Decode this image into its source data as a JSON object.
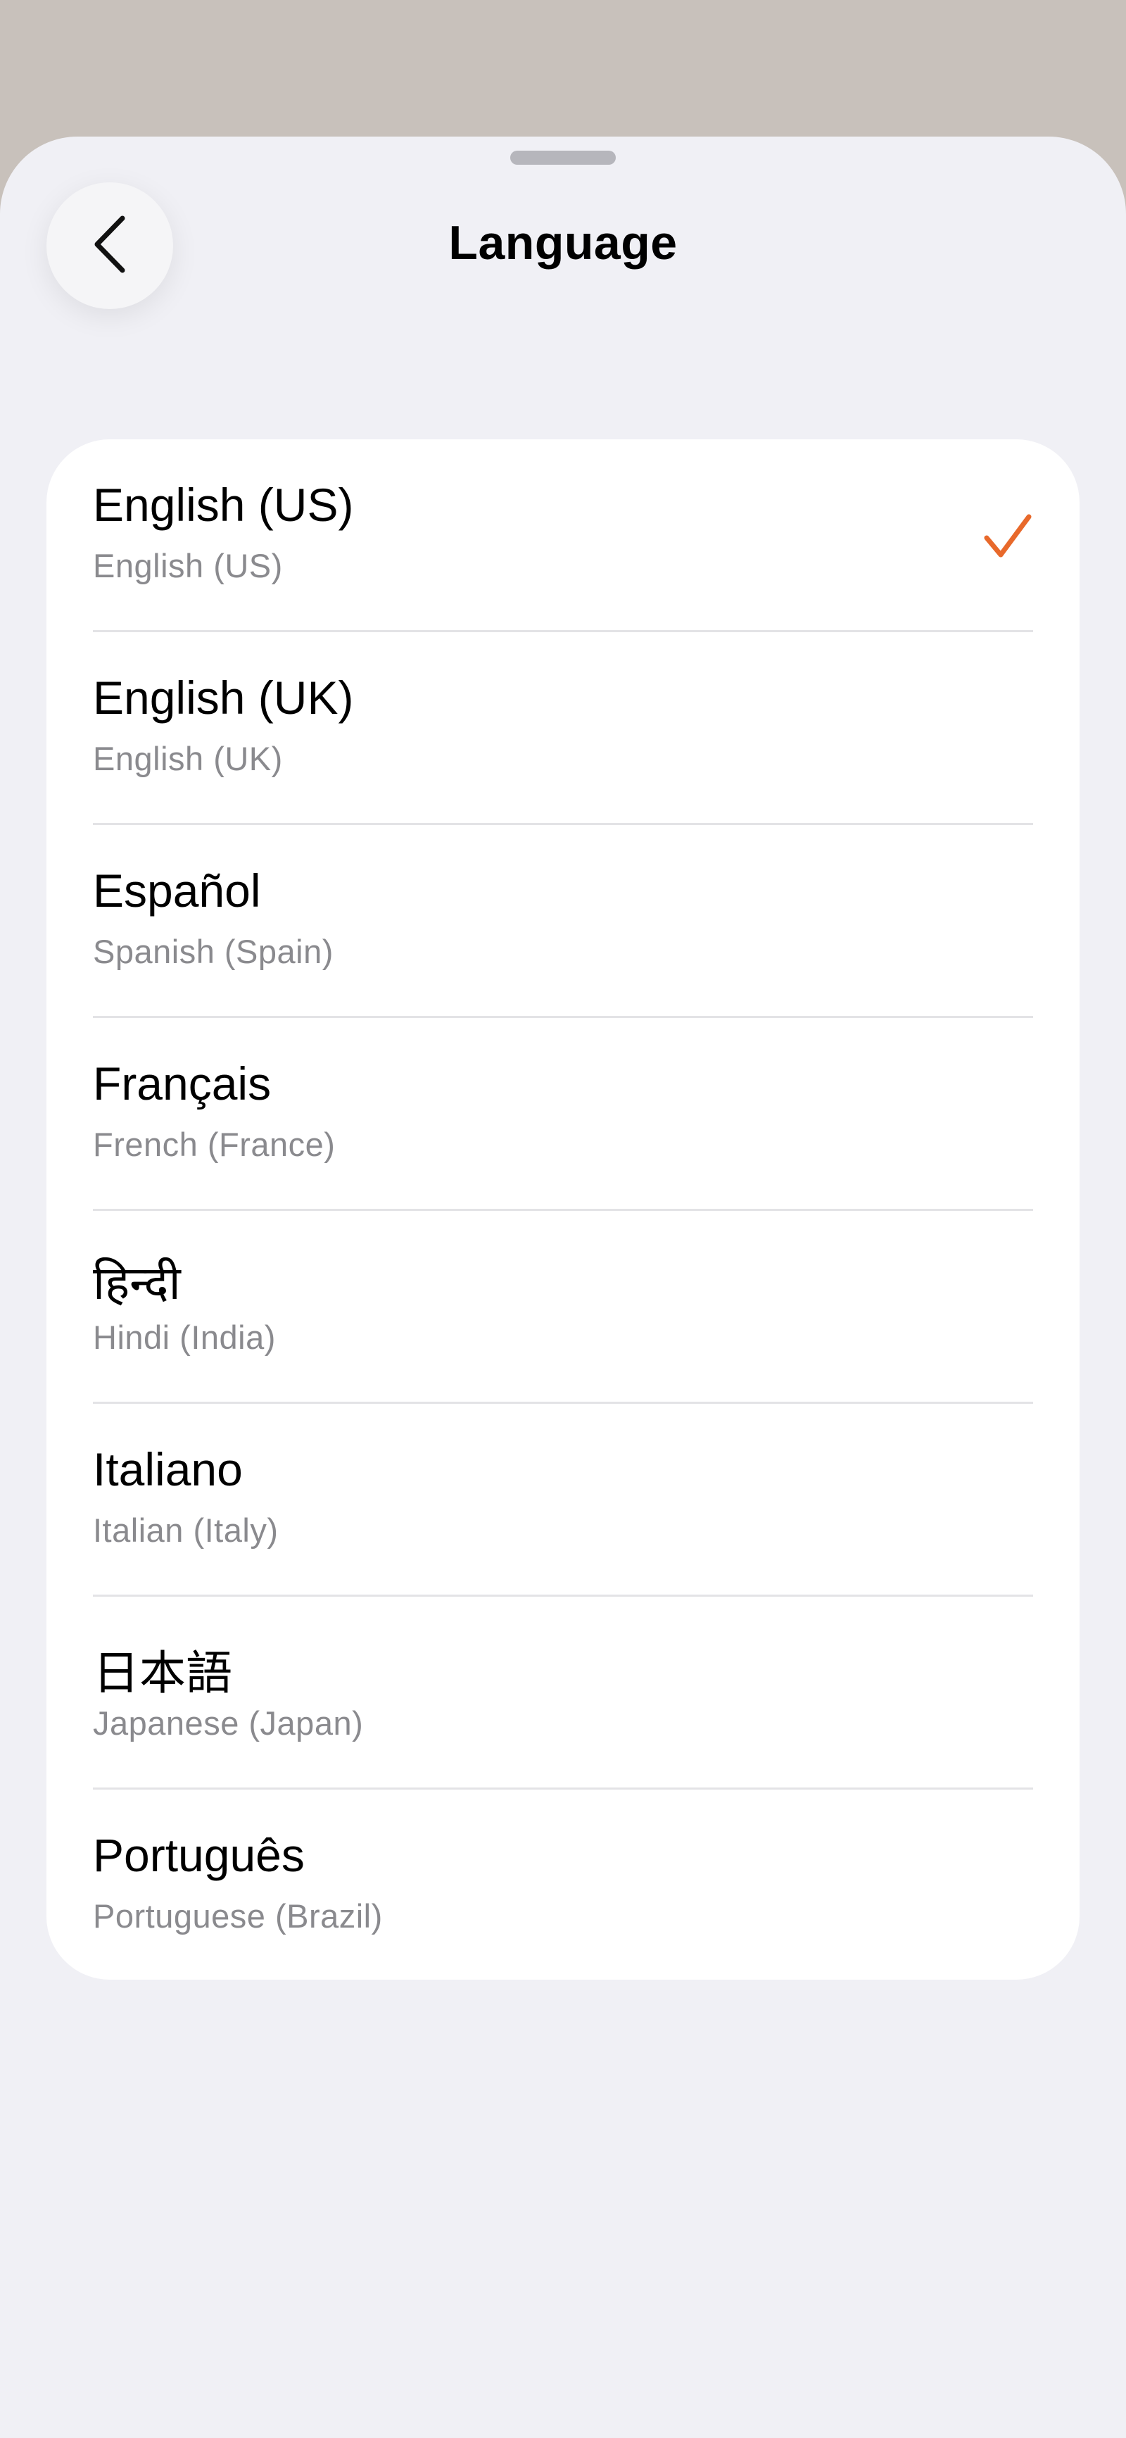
{
  "header": {
    "title": "Language"
  },
  "languages": [
    {
      "native": "English (US)",
      "english": "English (US)",
      "selected": true
    },
    {
      "native": "English (UK)",
      "english": "English (UK)",
      "selected": false
    },
    {
      "native": "Español",
      "english": "Spanish (Spain)",
      "selected": false
    },
    {
      "native": "Français",
      "english": "French (France)",
      "selected": false
    },
    {
      "native": "हिन्दी",
      "english": "Hindi (India)",
      "selected": false
    },
    {
      "native": "Italiano",
      "english": "Italian (Italy)",
      "selected": false
    },
    {
      "native": "日本語",
      "english": "Japanese (Japan)",
      "selected": false
    },
    {
      "native": "Português",
      "english": "Portuguese (Brazil)",
      "selected": false
    }
  ],
  "icons": {
    "back": "chevron-left-icon",
    "selected": "checkmark-icon"
  },
  "colors": {
    "accent": "#e8692b",
    "backdrop": "#c8c1bb",
    "sheet": "#f0f0f5"
  }
}
